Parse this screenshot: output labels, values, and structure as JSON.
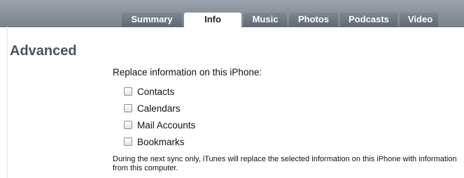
{
  "tabs": [
    "Summary",
    "Info",
    "Music",
    "Photos",
    "Podcasts",
    "Video"
  ],
  "active_tab": "Info",
  "section": {
    "title": "Advanced"
  },
  "replace": {
    "label": "Replace information on this iPhone:",
    "options": [
      {
        "label": "Contacts",
        "checked": false
      },
      {
        "label": "Calendars",
        "checked": false
      },
      {
        "label": "Mail Accounts",
        "checked": false
      },
      {
        "label": "Bookmarks",
        "checked": false
      }
    ]
  },
  "note": "During the next sync only, iTunes will replace the selected information on this iPhone with information from this computer."
}
